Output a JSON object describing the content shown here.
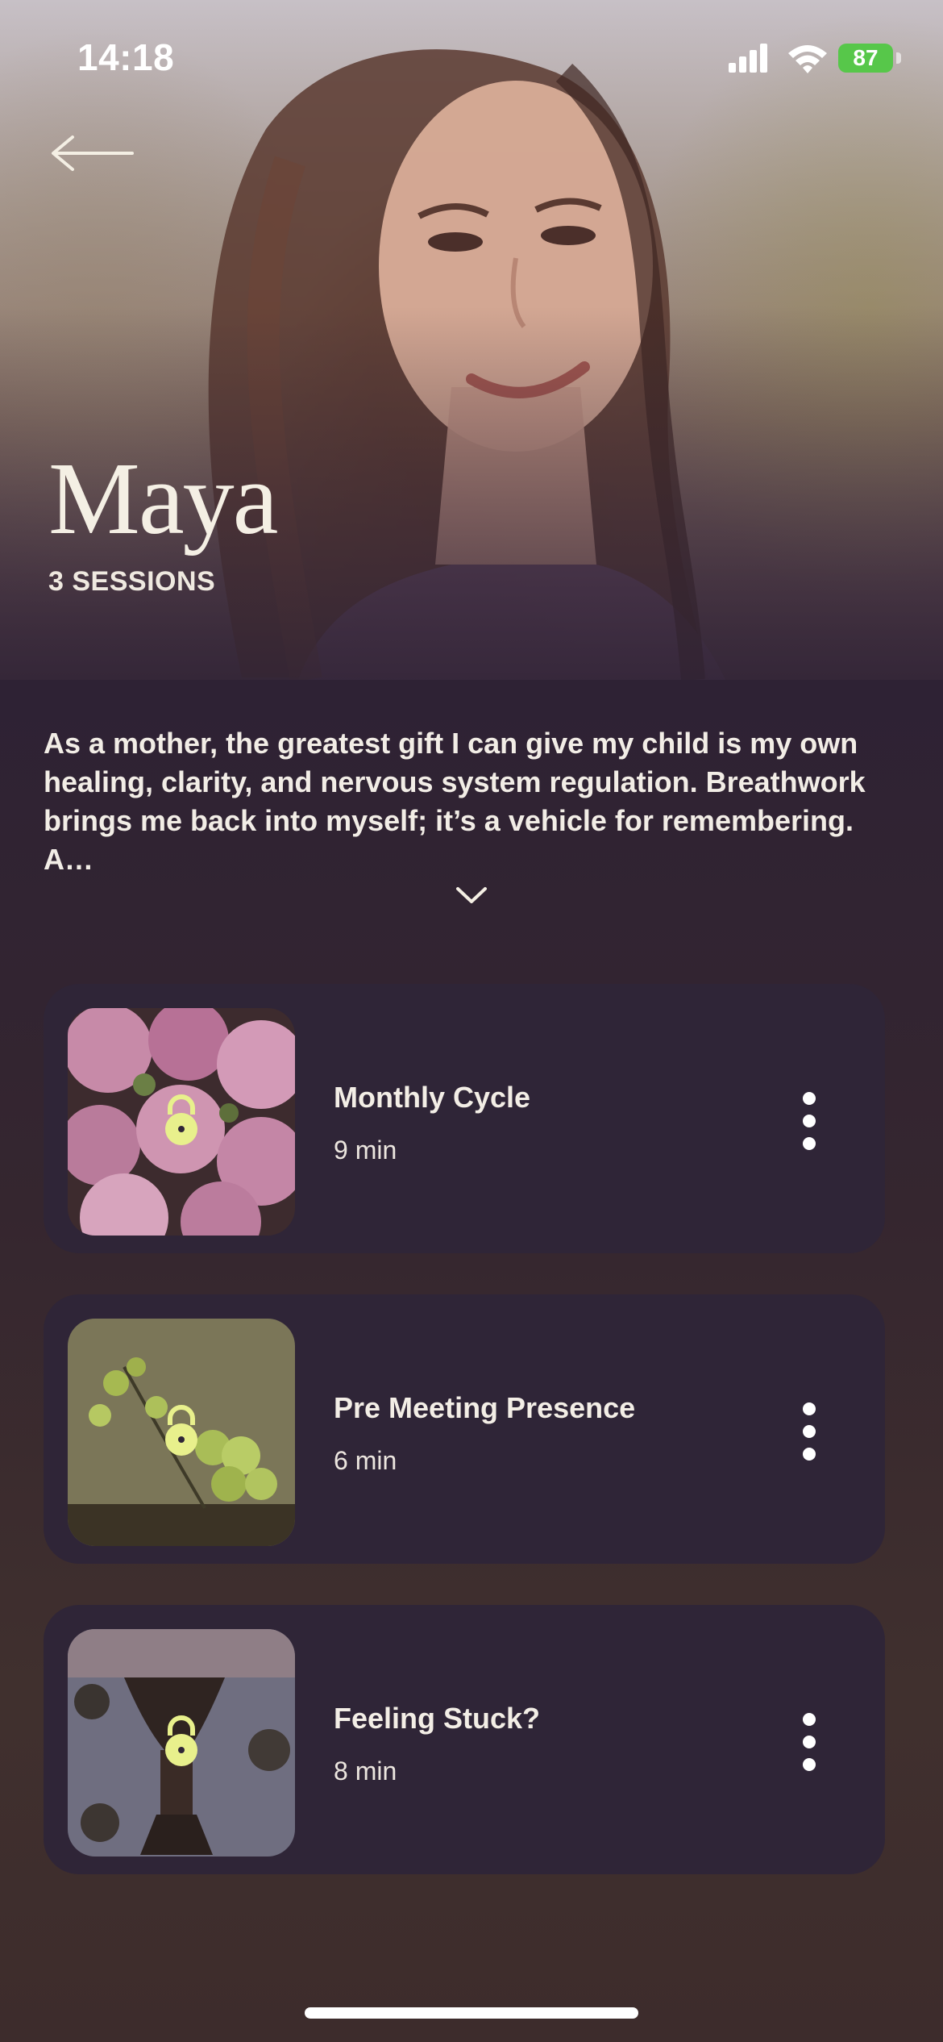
{
  "status_bar": {
    "time": "14:18",
    "battery_level": "87",
    "icons": [
      "cellular-signal-icon",
      "wifi-icon",
      "battery-charging-icon"
    ]
  },
  "header": {
    "back_icon": "arrow-left-icon"
  },
  "profile": {
    "name": "Maya",
    "sessions_label": "3 SESSIONS",
    "bio": "As a mother, the greatest gift I can give my child is my own healing, clarity, and nervous system regulation. Breathwork brings me back into myself; it’s a vehicle for remembering. A…",
    "expand_icon": "chevron-down-icon"
  },
  "sessions": [
    {
      "title": "Monthly Cycle",
      "duration": "9 min",
      "locked": true,
      "thumbnail": "pink-flowers"
    },
    {
      "title": "Pre Meeting Presence",
      "duration": "6 min",
      "locked": true,
      "thumbnail": "green-leaves"
    },
    {
      "title": "Feeling Stuck?",
      "duration": "8 min",
      "locked": true,
      "thumbnail": "water-reflection"
    }
  ],
  "colors": {
    "background": "#2e2234",
    "card": "#2f2537",
    "lock_accent": "#e8f08c",
    "battery": "#57c74a",
    "text": "#f3eee6"
  }
}
